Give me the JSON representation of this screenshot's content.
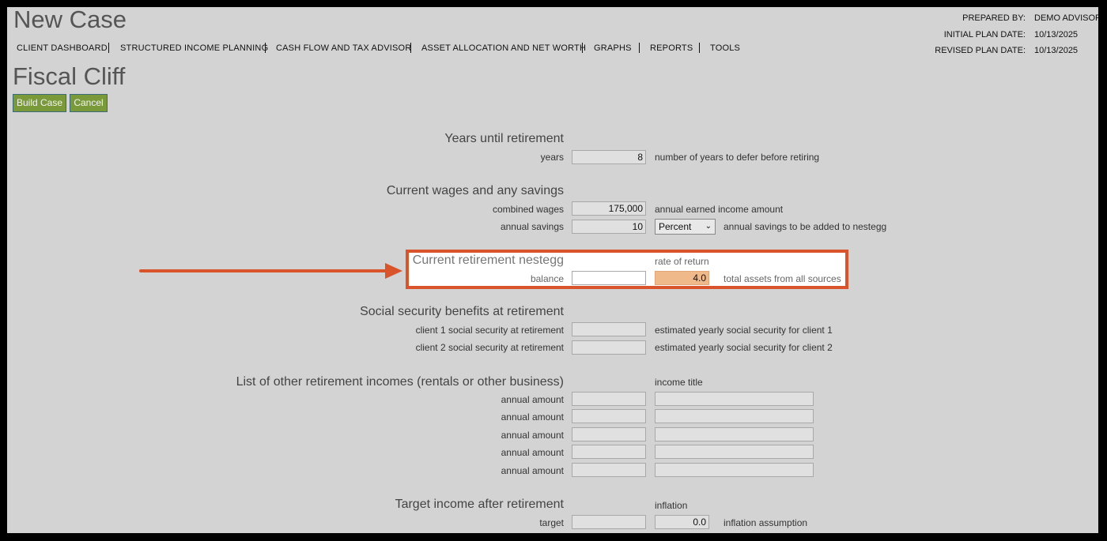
{
  "app": {
    "title": "New Case"
  },
  "nav": {
    "items": [
      "CLIENT DASHBOARD",
      "STRUCTURED INCOME PLANNING",
      "CASH FLOW AND TAX ADVISOR",
      "ASSET ALLOCATION AND NET WORTH",
      "GRAPHS",
      "REPORTS",
      "TOOLS"
    ]
  },
  "plan_meta": {
    "prepared_by_label": "PREPARED BY:",
    "prepared_by_value": "DEMO ADVISOR",
    "initial_date_label": "INITIAL PLAN DATE:",
    "initial_date_value": "10/13/2025",
    "revised_date_label": "REVISED PLAN DATE:",
    "revised_date_value": "10/13/2025"
  },
  "page": {
    "title": "Fiscal Cliff"
  },
  "actions": {
    "build_label": "Build Case",
    "cancel_label": "Cancel"
  },
  "years_section": {
    "title": "Years until retirement",
    "years_label": "years",
    "years_value": "8",
    "years_desc": "number of years to defer before retiring"
  },
  "wages_section": {
    "title": "Current wages and any savings",
    "wages_label": "combined wages",
    "wages_value": "175,000",
    "wages_desc": "annual earned income amount",
    "savings_label": "annual savings",
    "savings_value": "10",
    "savings_unit": "Percent",
    "savings_desc": "annual savings to be added to nestegg"
  },
  "nestegg_section": {
    "title": "Current retirement nestegg",
    "rate_header": "rate of return",
    "balance_label": "balance",
    "balance_value": "",
    "rate_value": "4.0",
    "desc": "total assets from all sources"
  },
  "ss_section": {
    "title": "Social security benefits at retirement",
    "client1_label": "client 1 social security at retirement",
    "client1_desc": "estimated yearly social security for client 1",
    "client2_label": "client 2 social security at retirement",
    "client2_desc": "estimated yearly social security for client 2"
  },
  "other_income_section": {
    "title": "List of other retirement incomes (rentals or other business)",
    "title_header": "income title",
    "rows": [
      {
        "label": "annual amount"
      },
      {
        "label": "annual amount"
      },
      {
        "label": "annual amount"
      },
      {
        "label": "annual amount"
      },
      {
        "label": "annual amount"
      }
    ]
  },
  "target_section": {
    "title": "Target income after retirement",
    "inflation_header": "inflation",
    "target_label": "target",
    "inflation_value": "0.0",
    "inflation_desc": "inflation assumption"
  },
  "colors": {
    "background": "#d3d3d3",
    "button_green": "#7a9a3a",
    "highlight_orange": "#d9542b",
    "rate_field_orange": "#f0b98a"
  },
  "icons": {
    "annotation": "arrow-right-icon",
    "dropdown": "chevron-down-icon"
  }
}
